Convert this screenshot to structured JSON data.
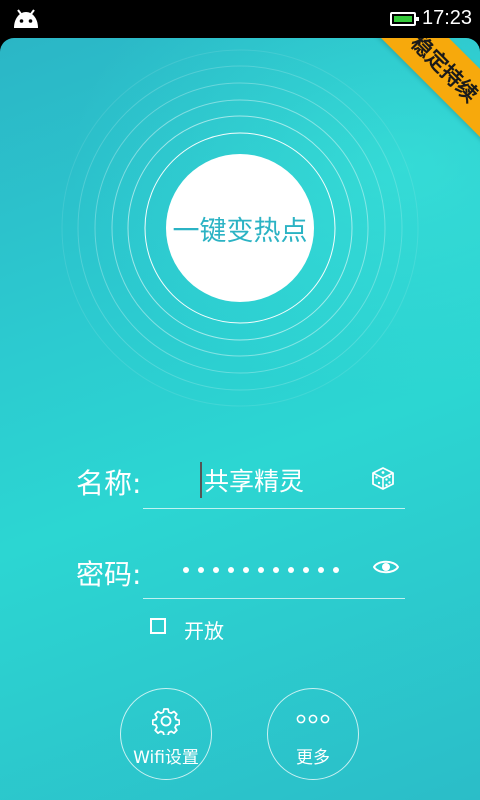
{
  "status_bar": {
    "time": "17:23",
    "battery_color": "#35c93a"
  },
  "ribbon": {
    "label": "稳定持续"
  },
  "hotspot_button": {
    "label": "一键变热点"
  },
  "form": {
    "name_label": "名称:",
    "name_value": "共享精灵",
    "password_label": "密码:",
    "password_mask_count": 11,
    "open_checkbox": {
      "label": "开放",
      "checked": false
    }
  },
  "bottom_buttons": {
    "wifi_settings": "Wifi设置",
    "more": "更多"
  },
  "icons": [
    "android-icon",
    "battery-icon",
    "dice-icon",
    "eye-icon",
    "gear-icon",
    "more-dots-icon"
  ],
  "colors": {
    "background": "#2cc3cc",
    "ribbon": "#f7a90c",
    "accent_text": "#2bb3c4"
  }
}
